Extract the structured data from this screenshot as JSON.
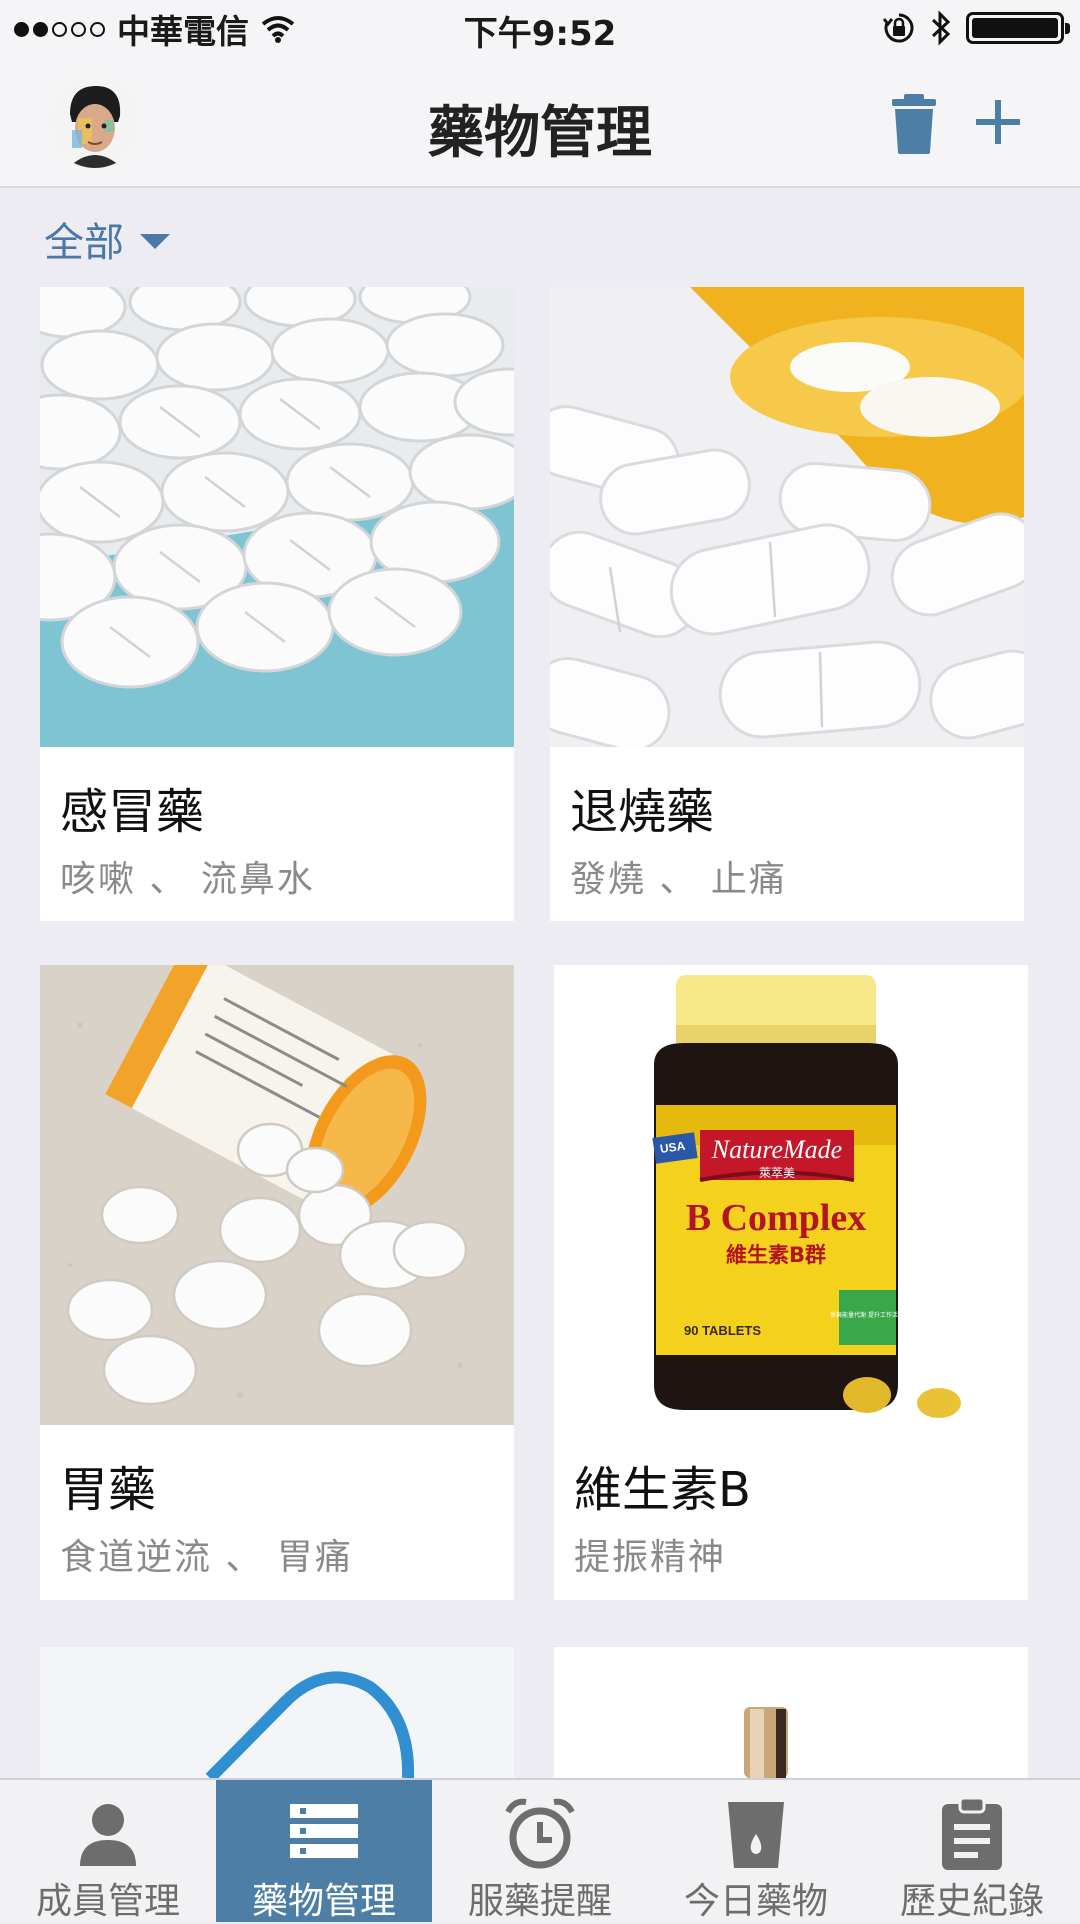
{
  "status_bar": {
    "carrier": "中華電信",
    "time": "下午9:52"
  },
  "nav": {
    "title": "藥物管理"
  },
  "filter": {
    "label": "全部"
  },
  "medications": [
    {
      "name": "感冒藥",
      "desc": "咳嗽 、 流鼻水"
    },
    {
      "name": "退燒藥",
      "desc": "發燒 、 止痛"
    },
    {
      "name": "胃藥",
      "desc": "食道逆流 、 胃痛"
    },
    {
      "name": "維生素B",
      "desc": "提振精神"
    }
  ],
  "product_label": {
    "brand": "NatureMade",
    "brand_cn": "萊萃美",
    "product": "B Complex",
    "product_cn": "維生素B群",
    "count": "90 TABLETS",
    "badge": "USA",
    "claim": "參與能量代謝 提升工作活力"
  },
  "tabs": [
    {
      "label": "成員管理",
      "icon": "person-icon"
    },
    {
      "label": "藥物管理",
      "icon": "list-icon"
    },
    {
      "label": "服藥提醒",
      "icon": "alarm-clock-icon"
    },
    {
      "label": "今日藥物",
      "icon": "cup-icon"
    },
    {
      "label": "歷史紀錄",
      "icon": "clipboard-icon"
    }
  ],
  "colors": {
    "accent": "#4D7EA6",
    "link": "#4A78A8",
    "background": "#EDECF2"
  }
}
